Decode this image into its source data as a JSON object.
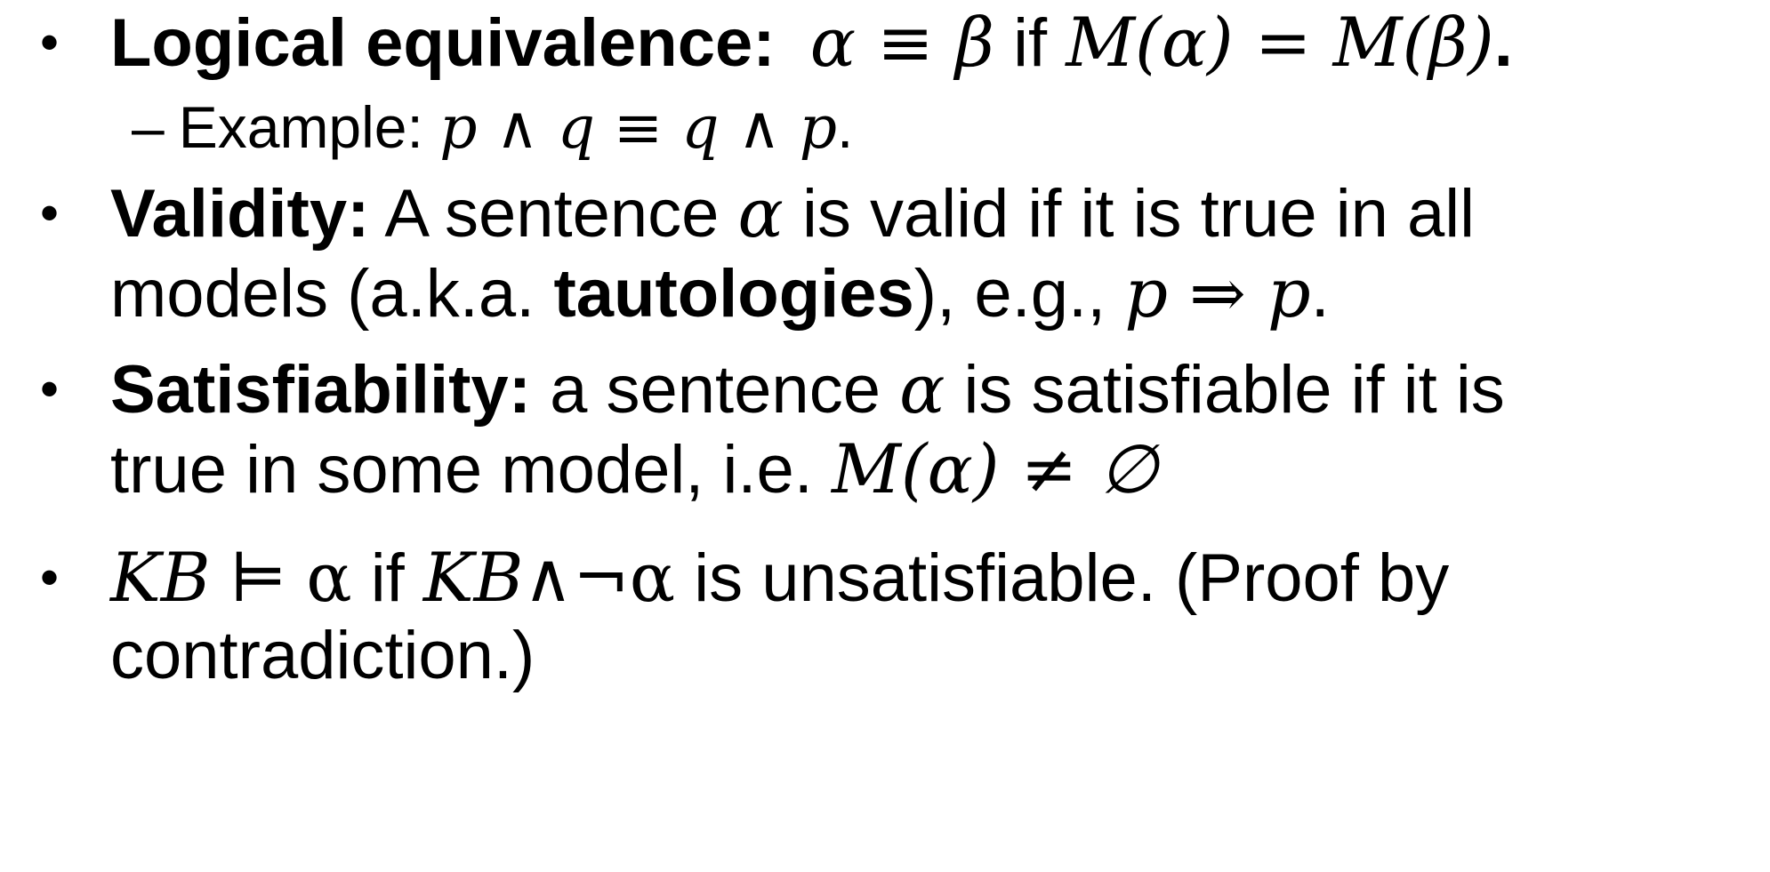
{
  "slide": {
    "items": [
      {
        "bullet": "•",
        "label": "Logical equivalence:",
        "m1": "α ≡ β",
        "t1": "if",
        "m2": "M(α) = M(β)",
        "t2": ".",
        "sub": {
          "dash": "–",
          "label": "Example:",
          "m": "p ∧ q ≡ q ∧ p",
          "t": "."
        }
      },
      {
        "bullet": "•",
        "label": "Validity:",
        "t1": "A sentence",
        "m1": "α",
        "t2": "is valid if it is true in all",
        "t3": "models (a.k.a.",
        "bold2": "tautologies",
        "t4": "), e.g.,",
        "m2": "p ⇒ p",
        "t5": "."
      },
      {
        "bullet": "•",
        "label": "Satisfiability:",
        "t1": "a sentence",
        "m1": "α",
        "t2": "is satisfiable if it is",
        "t3": "true in some model, i.e.",
        "m2": "M(α) ≠ ∅"
      },
      {
        "bullet": "•",
        "m1": "KB",
        "s1": "⊨",
        "s2": "α",
        "t1": "if",
        "m2": "KB",
        "s3": "∧¬α",
        "t2": "is unsatisfiable. (Proof by",
        "t3": "contradiction.)"
      }
    ]
  }
}
